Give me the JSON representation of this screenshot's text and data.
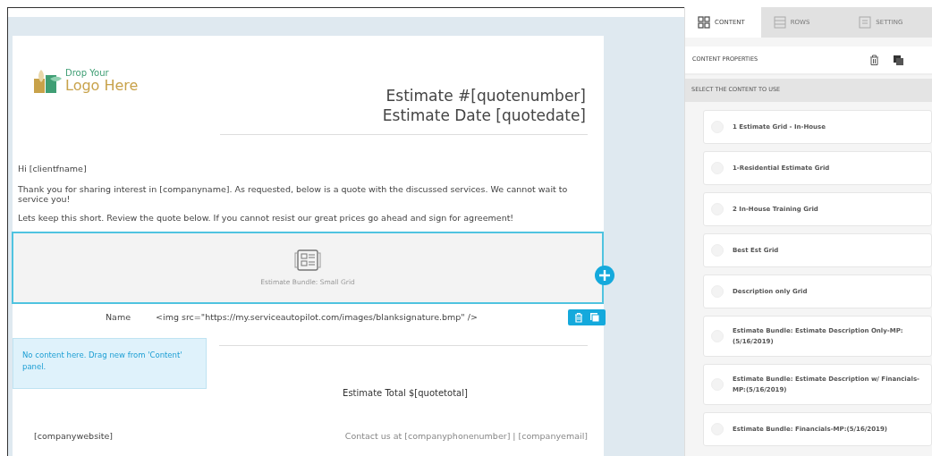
{
  "logo": {
    "line_1": "Drop Your",
    "line_2": "Logo Here"
  },
  "header": {
    "estimate_number": "Estimate #[quotenumber]",
    "estimate_date": "Estimate Date [quotedate]"
  },
  "paragraphs": [
    "Hi [clientfname]",
    "Thank you for sharing interest in [companyname]. As requested, below is a quote with the discussed services. We cannot wait to service you!",
    "Lets keep this short. Review the quote below. If you cannot resist our great prices go ahead and sign for agreement!"
  ],
  "content_block": {
    "caption": "Estimate Bundle: Small Grid",
    "selected": true
  },
  "signature_row": {
    "label": "Name",
    "value": "<img src=\"https://my.serviceautopilot.com/images/blanksignature.bmp\" />"
  },
  "empty_column": {
    "message": "No content here. Drag new from 'Content' panel."
  },
  "total": "Estimate Total $[quotetotal]",
  "footer": {
    "website": "[companywebsite]",
    "contact": "Contact us at [companyphonenumber] | [companyemail]"
  },
  "panel": {
    "tabs": [
      {
        "kind": "content",
        "label": "CONTENT",
        "selected": true
      },
      {
        "kind": "rows",
        "label": "ROWS",
        "selected": false
      },
      {
        "kind": "settings",
        "label": "SETTING",
        "selected": false
      }
    ],
    "properties_title": "CONTENT PROPERTIES",
    "select_title": "SELECT THE CONTENT TO USE",
    "items": [
      {
        "label": "1 Estimate Grid - In-House",
        "selected": false
      },
      {
        "label": "1-Residential Estimate Grid",
        "selected": false
      },
      {
        "label": "2 In-House Training Grid",
        "selected": false
      },
      {
        "label": "Best Est Grid",
        "selected": false
      },
      {
        "label": "Description only Grid",
        "selected": false
      },
      {
        "label": "Estimate Bundle: Estimate Description Only-MP:(5/16/2019)",
        "selected": false
      },
      {
        "label": "Estimate Bundle: Estimate Description w/ Financials-MP:(5/16/2019)",
        "selected": false
      },
      {
        "label": "Estimate Bundle: Financials-MP:(5/16/2019)",
        "selected": false
      }
    ]
  }
}
